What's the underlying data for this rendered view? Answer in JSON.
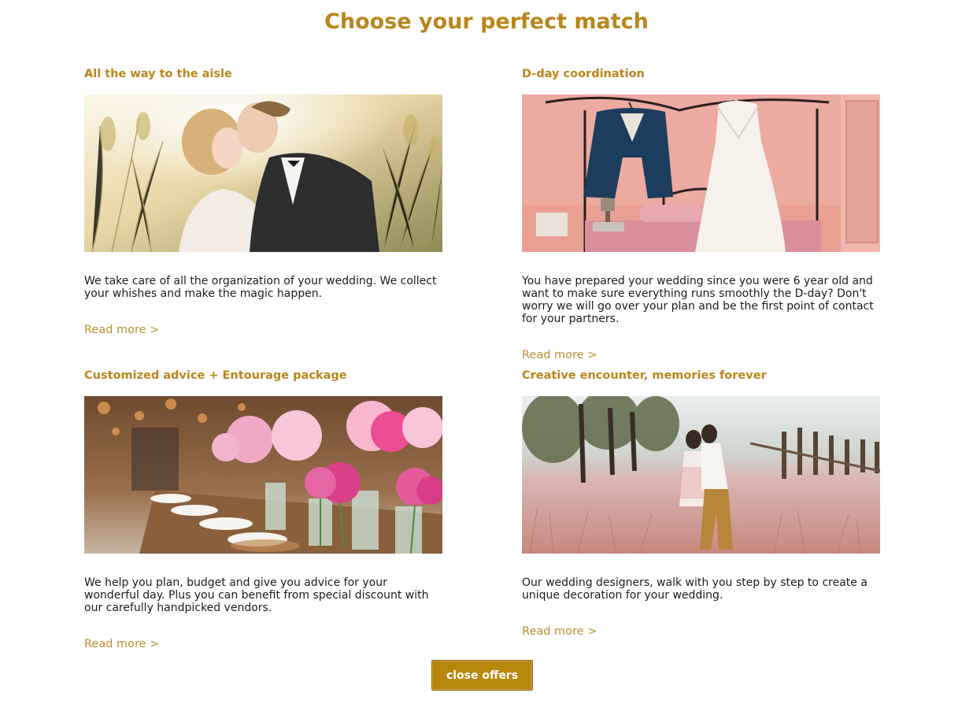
{
  "page": {
    "title": "Choose your perfect match"
  },
  "offers": [
    {
      "title": "All the way to the aisle",
      "image_alt": "Couple kissing in a field of tall grass at sunset",
      "description": "We take care of all the organization of your wedding. We collect your whishes and make the magic happen.",
      "read_more": "Read more >"
    },
    {
      "title": "D-day coordination",
      "image_alt": "Groom's navy suit and white wedding dress hanging in a pink bedroom",
      "description": "You have prepared your wedding since you were 6 year old and want to make sure everything runs smoothly the D-day? Don't worry we will go over your plan and be the first point of contact for your partners.",
      "read_more": "Read more >"
    },
    {
      "title": "Customized advice + Entourage package",
      "image_alt": "Banquet table with pink hydrangea and rose centerpieces",
      "description": "We help you plan, budget and give you advice for your wonderful day. Plus you can benefit from special discount with our carefully handpicked vendors.",
      "read_more": "Read more >"
    },
    {
      "title": "Creative encounter, memories forever",
      "image_alt": "Couple kissing in a field of pink grass beside a wooden fence",
      "description": "Our wedding designers, walk with you step by step to create a unique decoration for your wedding.",
      "read_more": "Read more >"
    }
  ],
  "actions": {
    "close_label": "close offers"
  },
  "colors": {
    "accent": "#b8861b",
    "button": "#b8860b",
    "text": "#1b1b1b"
  }
}
